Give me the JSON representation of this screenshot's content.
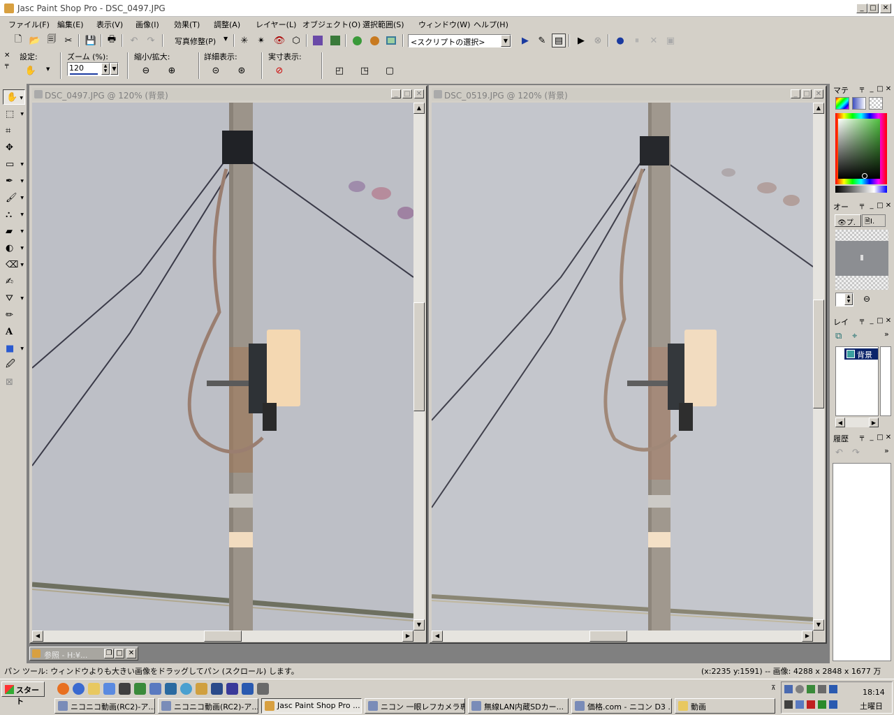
{
  "window": {
    "title": "Jasc Paint Shop Pro - DSC_0497.JPG",
    "min": "_",
    "max": "□",
    "close": "✕"
  },
  "menu": [
    "ファイル(F)",
    "編集(E)",
    "表示(V)",
    "画像(I)",
    "効果(T)",
    "調整(A)",
    "レイヤー(L)",
    "オブジェクト(O)",
    "選択範囲(S)",
    "ウィンドウ(W)",
    "ヘルプ(H)"
  ],
  "toolbar": {
    "photo_fix": "写真修整(P)",
    "script_select": "<スクリプトの選択>"
  },
  "tool_options": {
    "setting_label": "設定:",
    "zoom_label": "ズーム (%):",
    "zoom_value": "120",
    "zoom_inout_label": "縮小/拡大:",
    "detail_label": "詳細表示:",
    "actual_label": "実寸表示:"
  },
  "documents": [
    {
      "title": "DSC_0497.JPG @ 120% (背景)"
    },
    {
      "title": "DSC_0519.JPG @ 120% (背景)"
    }
  ],
  "minimized_doc": {
    "title": "参照 - H:¥..."
  },
  "palettes": {
    "materials": "マテ",
    "overview": "オー",
    "overview_tab1": "プ.",
    "overview_tab2": "I.",
    "layers": "レイ",
    "layer_name": "背景",
    "history": "履歴"
  },
  "status": {
    "hint": "パン ツール: ウィンドウよりも大きい画像をドラッグしてパン (スクロール) します。",
    "info": "(x:2235 y:1591) -- 画像:  4288 x 2848 x 1677 万"
  },
  "taskbar": {
    "start": "スタート",
    "tasks": [
      "ニコニコ動画(RC2)-ア...",
      "ニコニコ動画(RC2)-ア...",
      "Jasc Paint Shop Pro ...",
      "ニコン 一眼レフカメラ専...",
      "無線LAN内蔵SDカー...",
      "価格.com - ニコン D3 ...",
      "動画"
    ],
    "active_task_index": 2,
    "clock_time": "18:14",
    "clock_day": "土曜日"
  },
  "colors": {
    "sky": "#bdbfc6",
    "pole": "#9c948a",
    "box": "#f4d8b2"
  }
}
